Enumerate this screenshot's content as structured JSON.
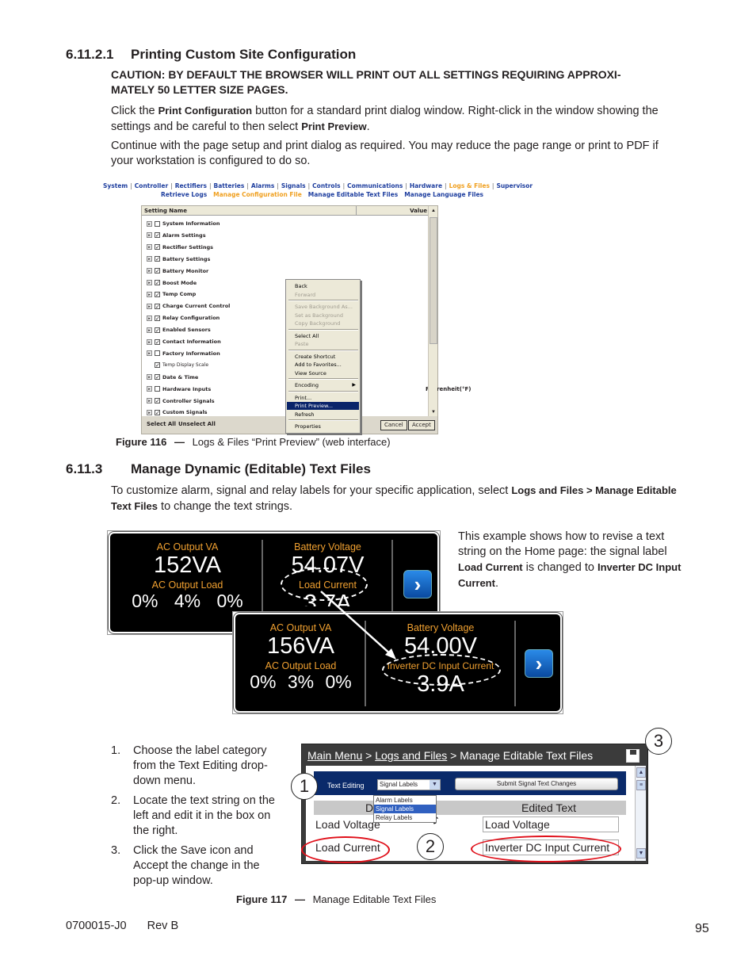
{
  "section_6_11_2_1": {
    "number": "6.11.2.1",
    "title": "Printing Custom Site Configuration",
    "caution_line1": "CAUTION: BY DEFAULT THE BROWSER WILL PRINT OUT ALL SETTINGS REQUIRING APPROXI-",
    "caution_line2": "MATELY 50 LETTER SIZE PAGES.",
    "para1": {
      "t1": "Click the ",
      "b1": "Print Configuration",
      "t2": " button for a standard print dialog window. Right-click in the window showing the settings and be careful to then select ",
      "b2": "Print Preview",
      "t3": "."
    },
    "para2": "Continue with the page setup and print dialog as required. You may reduce the page range or print to PDF if your workstation is configured to do so."
  },
  "figure116": {
    "top_nav": [
      "System",
      "Controller",
      "Rectifiers",
      "Batteries",
      "Alarms",
      "Signals",
      "Controls",
      "Communications",
      "Hardware",
      "Logs & Files",
      "Supervisor"
    ],
    "top_nav_active": "Logs & Files",
    "sub_nav": [
      "Retrieve Logs",
      "Manage Configuration File",
      "Manage Editable Text Files",
      "Manage Language Files"
    ],
    "sub_nav_active": "Manage Configuration File",
    "columns": {
      "name": "Setting Name",
      "value": "Value"
    },
    "settings": [
      {
        "label": "System Information",
        "checked": false,
        "expandable": true
      },
      {
        "label": "Alarm Settings",
        "checked": true,
        "expandable": true
      },
      {
        "label": "Rectifier Settings",
        "checked": true,
        "expandable": true
      },
      {
        "label": "Battery Settings",
        "checked": true,
        "expandable": true
      },
      {
        "label": "Battery Monitor",
        "checked": true,
        "expandable": true
      },
      {
        "label": "Boost Mode",
        "checked": true,
        "expandable": true
      },
      {
        "label": "Temp Comp",
        "checked": true,
        "expandable": true
      },
      {
        "label": "Charge Current Control",
        "checked": true,
        "expandable": true
      },
      {
        "label": "Relay Configuration",
        "checked": true,
        "expandable": true
      },
      {
        "label": "Enabled Sensors",
        "checked": true,
        "expandable": true
      },
      {
        "label": "Contact Information",
        "checked": true,
        "expandable": true
      },
      {
        "label": "Factory Information",
        "checked": false,
        "expandable": true
      },
      {
        "label": "Temp Display Scale",
        "checked": true,
        "expandable": false,
        "value": "Fahrenheit(°F)"
      },
      {
        "label": "Date & Time",
        "checked": true,
        "expandable": true
      },
      {
        "label": "Hardware Inputs",
        "checked": false,
        "expandable": true
      },
      {
        "label": "Controller Signals",
        "checked": true,
        "expandable": true
      },
      {
        "label": "Custom Signals",
        "checked": true,
        "expandable": true
      }
    ],
    "temp_value": "Fahrenheit(°F)",
    "select_all": "Select All",
    "unselect_all": "Unselect All",
    "cancel": "Cancel",
    "accept": "Accept",
    "context_menu": [
      {
        "label": "Back",
        "state": "enabled"
      },
      {
        "label": "Forward",
        "state": "disabled"
      },
      {
        "sep": true
      },
      {
        "label": "Save Background As...",
        "state": "disabled"
      },
      {
        "label": "Set as Background",
        "state": "disabled"
      },
      {
        "label": "Copy Background",
        "state": "disabled"
      },
      {
        "sep": true
      },
      {
        "label": "Select All",
        "state": "enabled"
      },
      {
        "label": "Paste",
        "state": "disabled"
      },
      {
        "sep": true
      },
      {
        "label": "Create Shortcut",
        "state": "enabled"
      },
      {
        "label": "Add to Favorites...",
        "state": "enabled"
      },
      {
        "label": "View Source",
        "state": "enabled"
      },
      {
        "sep": true
      },
      {
        "label": "Encoding",
        "state": "enabled",
        "submenu": true
      },
      {
        "sep": true
      },
      {
        "label": "Print...",
        "state": "enabled"
      },
      {
        "label": "Print Preview...",
        "state": "selected"
      },
      {
        "label": "Refresh",
        "state": "enabled"
      },
      {
        "sep": true
      },
      {
        "label": "Properties",
        "state": "enabled"
      }
    ],
    "caption_num": "Figure 116",
    "caption_dash": "—",
    "caption_text": "Logs & Files “Print Preview” (web interface)"
  },
  "section_6_11_3": {
    "number": "6.11.3",
    "title": "Manage Dynamic (Editable) Text Files",
    "para": {
      "t1": "To customize alarm, signal and relay labels for your specific application, select ",
      "b1": "Logs and Files > Manage Editable Text Files",
      "t2": " to change the text strings."
    }
  },
  "home_example": {
    "before": {
      "ac_va_label": "AC Output VA",
      "ac_va_value": "152VA",
      "ac_load_label": "AC Output Load",
      "ac_load_values": "0% 4% 0%",
      "batt_label": "Battery Voltage",
      "batt_value": "54.07V",
      "signal_label": "Load Current",
      "signal_value": "3.7A"
    },
    "after": {
      "ac_va_label": "AC Output VA",
      "ac_va_value": "156VA",
      "ac_load_label": "AC Output Load",
      "ac_load_values": "0% 3% 0%",
      "batt_label": "Battery Voltage",
      "batt_value": "54.00V",
      "signal_label": "Inverter DC Input Current",
      "signal_value": "3.9A"
    },
    "note": {
      "t1": "This example shows how to revise a text string on the Home page: the signal label ",
      "b1": "Load Current",
      "t2": " is changed to ",
      "b2": "Inverter DC Input Current",
      "t3": "."
    }
  },
  "steps": [
    {
      "n": "1.",
      "text": "Choose the label category from the Text Editing drop-down menu."
    },
    {
      "n": "2.",
      "text": "Locate the text string on the left and edit it in the box on the right."
    },
    {
      "n": "3.",
      "text": "Click the Save icon and Accept the change in the pop-up window."
    }
  ],
  "figure117": {
    "breadcrumb": {
      "main_menu": "Main Menu",
      "sep": " > ",
      "logs": "Logs and Files",
      "current": "Manage Editable Text Files"
    },
    "text_editing_label": "Text Editing",
    "selected_option": "Signal Labels",
    "options": [
      "Alarm Labels",
      "Signal Labels",
      "Relay Labels"
    ],
    "submit_button": "Submit Signal Text Changes",
    "col_default": "Default Text",
    "col_default_visible": "D",
    "col_edited": "Edited Text",
    "rows": [
      {
        "default": "Load Voltage",
        "edited": "Load Voltage"
      },
      {
        "default": "Load Current",
        "edited": "Inverter DC Input Current"
      }
    ],
    "callouts": [
      "1",
      "2",
      "3"
    ],
    "caption_num": "Figure 117",
    "caption_dash": "—",
    "caption_text": "Manage Editable Text Files"
  },
  "footer": {
    "doc_id": "0700015-J0",
    "rev": "Rev B",
    "page": "95"
  }
}
